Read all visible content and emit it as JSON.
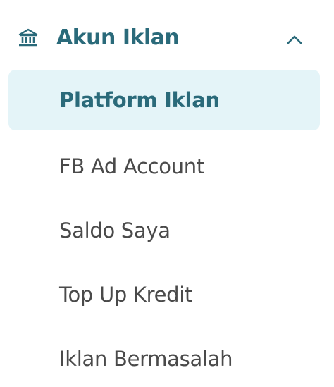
{
  "header": {
    "label": "Akun Iklan",
    "icon": "bank-icon",
    "expanded": true
  },
  "items": [
    {
      "label": "Platform Iklan",
      "active": true
    },
    {
      "label": "FB Ad Account",
      "active": false
    },
    {
      "label": "Saldo Saya",
      "active": false
    },
    {
      "label": "Top Up Kredit",
      "active": false
    },
    {
      "label": "Iklan Bermasalah",
      "active": false
    }
  ],
  "colors": {
    "accent": "#2a6a7a",
    "active_bg": "#e4f4f8",
    "text": "#4a4a4a"
  }
}
